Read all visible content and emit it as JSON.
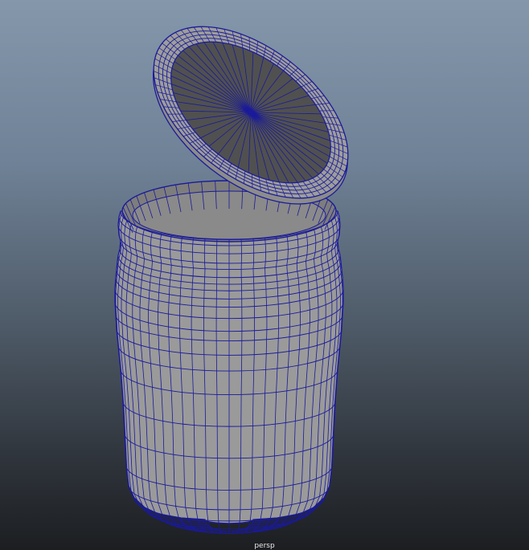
{
  "viewport": {
    "camera_label": "persp",
    "background_top": "#8497ab",
    "background_bottom": "#1c1e21"
  },
  "scene": {
    "objects": [
      "jar-body",
      "jar-lid"
    ],
    "wireframe_color": "#1a1a9a",
    "shaded_color": "#9a9a9a",
    "shaded_dark_color": "#505050"
  }
}
